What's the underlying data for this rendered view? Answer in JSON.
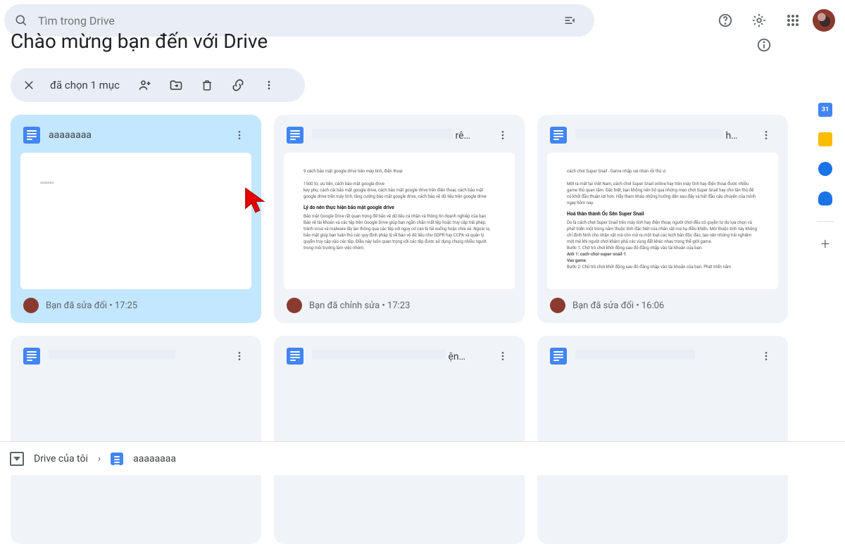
{
  "search": {
    "placeholder": "Tìm trong Drive"
  },
  "page": {
    "title": "Chào mừng bạn đến với Drive"
  },
  "selection": {
    "label": "đã chọn 1 mục"
  },
  "files": [
    {
      "name": "aaaaaaaa",
      "meta": "Bạn đã sửa đổi • 17:25",
      "selected": true,
      "truncated": ""
    },
    {
      "name": "",
      "meta": "Bạn đã chỉnh sửa • 17:23",
      "selected": false,
      "truncated": "rê…"
    },
    {
      "name": "",
      "meta": "Bạn đã sửa đổi • 16:06",
      "selected": false,
      "truncated": "h…"
    },
    {
      "name": "",
      "meta": "",
      "selected": false,
      "truncated": ""
    },
    {
      "name": "",
      "meta": "",
      "selected": false,
      "truncated": "ện…"
    },
    {
      "name": "",
      "meta": "",
      "selected": false,
      "truncated": ""
    }
  ],
  "thumbs": {
    "t1": "aaaaaaa",
    "t2": {
      "l1": "9 cách bảo mật google drive trên máy tính, điện thoại",
      "l2": "1500 từ, ưu tiên, cách bảo mật google drive",
      "l3": "key phụ: cách cài bảo mật google drive, cách bảo mật google drive trên điện thoại, cách bảo mật google drive trên máy tính, tăng cường bảo mật google drive, cách bảo vệ dữ liệu trên google drive",
      "h": "Lý do nên thực hiện bảo mật google drive",
      "l4": "Bảo mật Google Drive rất quan trọng để bảo vệ dữ liệu cá nhân và thông tin doanh nghiệp của bạn. Bảo vệ tài khoản và các tệp trên Google Drive giúp bạn ngăn chặn mất tệp hoặc truy cập trái phép, tránh virus và malware lây lan thông qua các tệp với nguy cơ cao bị tải xuống hoặc chia sẻ. Ngoài ra, bảo mật giúp bạn tuân thủ các quy định pháp lý về bảo vệ dữ liệu như GDPR hay CCPA và quản lý quyền truy cập vào các tệp. Điều này luôn quan trọng với các tệp được sử dụng chung nhiều người trong môi trường làm việc nhóm."
    },
    "t3": {
      "l1": "cách chơi Super Snail - Game nhập vai nhàn rỗi thú vị",
      "l2": "Mới ra mắt tại Việt Nam, cách chơi Super Snail online hay trên máy tính hay điện thoại được nhiều game thủ quan tâm. Đặc biệt, bạn không nên bỏ qua những mẹo chơi Super Snail hay cho tân thủ để có khởi đầu thuận lợi hơn. Hãy tham khảo những hướng dẫn sau đây và bắt đầu câu chuyện của mình ngay hôm nay.",
      "h": "Hoá thân thành Ốc Sên Super Snail",
      "l3": "Do là cách chơi Super Snail trên máy tính hay điện thoại, người chơi đều có quyền tự do lựa chọn và phát triển một trong năm thuộc tính đặc biệt của nhân vật ma hạ điều khiển. Mỗi thuộc tính này không chỉ định hình cho nhân vật mà còn mở ra một loạt các kịch bản độc đáo, tạo nên những trải nghiệm mới mẻ khi người chơi khám phá các vùng đất khác nhau trong thế giới game.",
      "l4": "Bước 1: Chờ trò chơi khởi động sau đó đăng nhập vào tài khoản của bạn.",
      "l5": "Anh 1: cach-choi-super-snail-1",
      "l6": "Vao game",
      "l7": "Bước 2: Chờ trò chơi khởi động sau đó đăng nhập vào tài khoản của bạn. Phát triển năm"
    }
  },
  "breadcrumb": {
    "root": "Drive của tôi",
    "file": "aaaaaaaa"
  }
}
